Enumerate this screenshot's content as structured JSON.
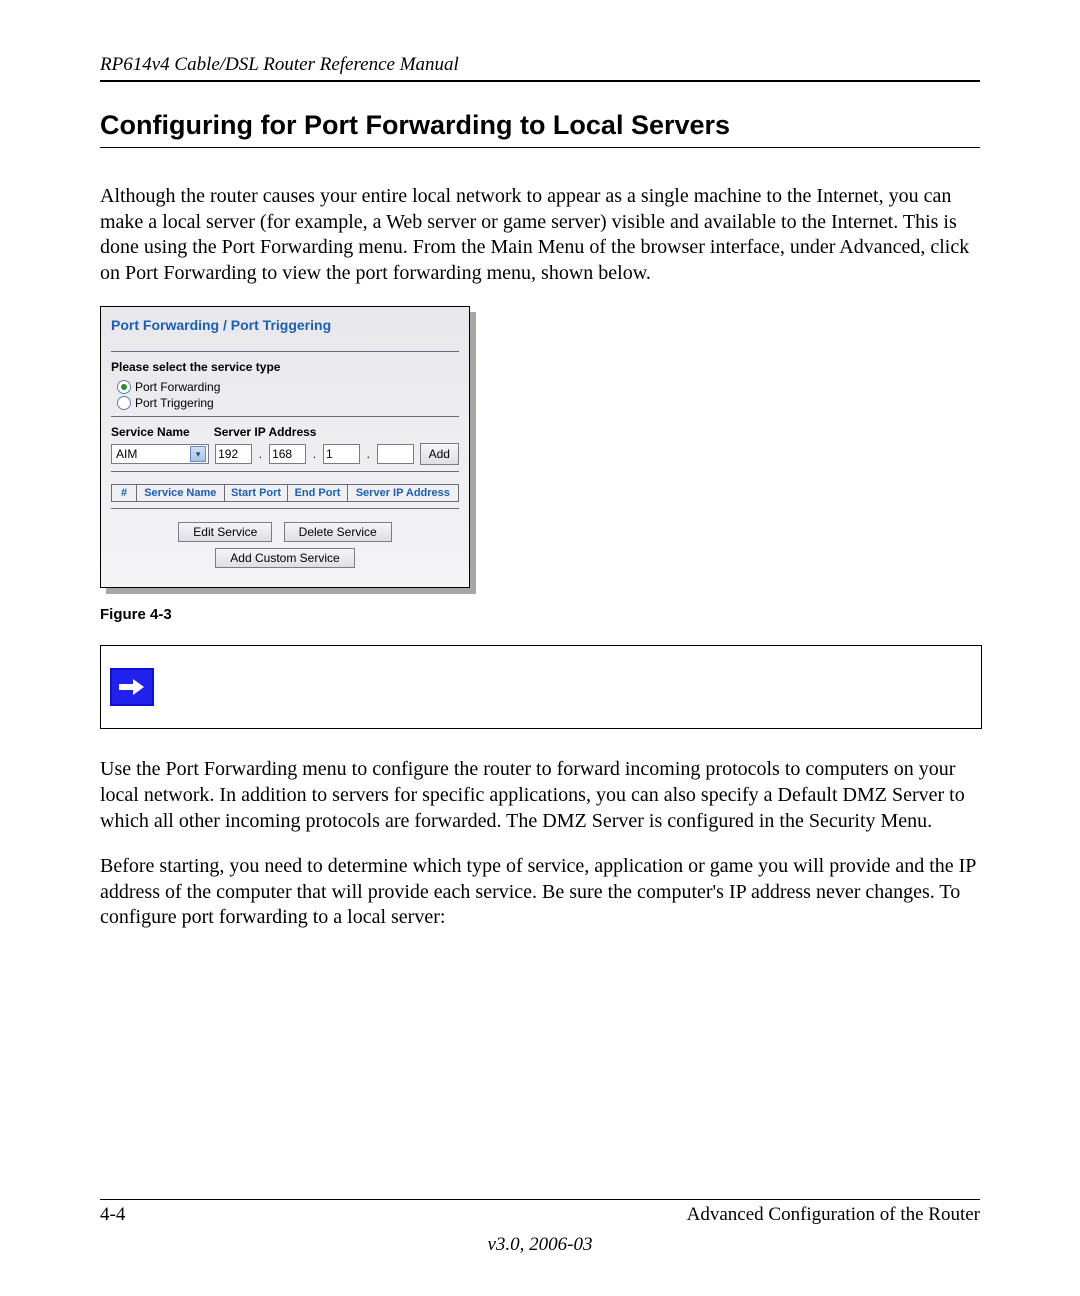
{
  "header": {
    "running": "RP614v4 Cable/DSL Router Reference Manual"
  },
  "section": {
    "title": "Configuring for Port Forwarding to Local Servers",
    "intro": "Although the router causes your entire local network to appear as a single machine to the Internet, you can make a local server (for example, a Web server or game server) visible and available to the Internet. This is done using the Port Forwarding menu. From the Main Menu of the browser interface, under Advanced, click on Port Forwarding to view the port forwarding menu, shown below."
  },
  "router_panel": {
    "title": "Port Forwarding / Port Triggering",
    "select_type_label": "Please select the service type",
    "radio_forwarding": "Port Forwarding",
    "radio_triggering": "Port Triggering",
    "svc_name_label": "Service Name",
    "svc_ip_label": "Server IP Address",
    "svc_select_value": "AIM",
    "ip": {
      "o1": "192",
      "o2": "168",
      "o3": "1",
      "o4": ""
    },
    "add_btn": "Add",
    "table_headers": {
      "hash": "#",
      "name": "Service Name",
      "sport": "Start Port",
      "eport": "End Port",
      "addr": "Server IP Address"
    },
    "btn_edit": "Edit Service",
    "btn_delete": "Delete Service",
    "btn_custom": "Add Custom Service"
  },
  "figure_caption": "Figure 4-3",
  "para2": "Use the Port Forwarding menu to configure the router to forward incoming protocols to computers on your local network. In addition to servers for specific applications, you can also specify a Default DMZ Server to which all other incoming protocols are forwarded. The DMZ Server is configured in the Security Menu.",
  "para3": "Before starting, you need to determine which type of service, application or game you will provide and the IP address of the computer that will provide each service. Be sure the computer's IP address never changes. To configure port forwarding to a local server:",
  "footer": {
    "page": "4-4",
    "chapter": "Advanced Configuration of the Router",
    "version": "v3.0, 2006-03"
  }
}
